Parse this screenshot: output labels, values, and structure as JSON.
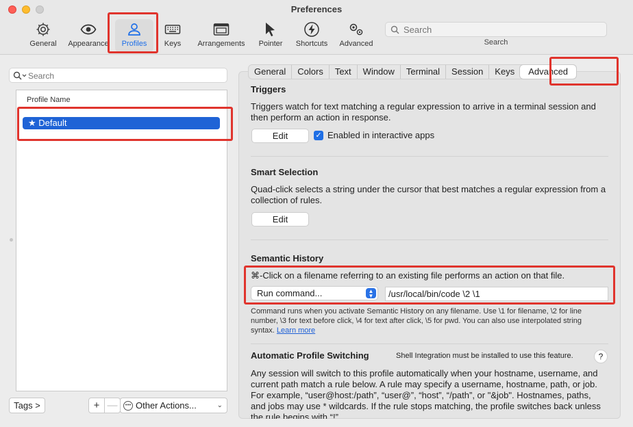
{
  "window": {
    "title": "Preferences"
  },
  "toolbar": {
    "items": [
      {
        "label": "General",
        "icon": "gear-icon"
      },
      {
        "label": "Appearance",
        "icon": "eye-icon"
      },
      {
        "label": "Profiles",
        "icon": "person-icon",
        "selected": true
      },
      {
        "label": "Keys",
        "icon": "keyboard-icon"
      },
      {
        "label": "Arrangements",
        "icon": "windows-icon"
      },
      {
        "label": "Pointer",
        "icon": "cursor-icon"
      },
      {
        "label": "Shortcuts",
        "icon": "lightning-icon"
      },
      {
        "label": "Advanced",
        "icon": "gears-icon"
      }
    ],
    "search": {
      "placeholder": "Search",
      "label": "Search"
    }
  },
  "profiles": {
    "search_placeholder": "Search",
    "column_header": "Profile Name",
    "rows": [
      {
        "name": "★ Default",
        "selected": true
      }
    ],
    "tags_button": "Tags >",
    "add_button": "+",
    "remove_button": "—",
    "other_actions": "Other Actions..."
  },
  "tabs": [
    "General",
    "Colors",
    "Text",
    "Window",
    "Terminal",
    "Session",
    "Keys",
    "Advanced"
  ],
  "selected_tab": "Advanced",
  "advanced": {
    "triggers": {
      "title": "Triggers",
      "description": "Triggers watch for text matching a regular expression to arrive in a terminal session and then perform an action in response.",
      "edit_button": "Edit",
      "enabled_label": "Enabled in interactive apps",
      "enabled_checked": true
    },
    "smart_selection": {
      "title": "Smart Selection",
      "description": "Quad-click selects a string under the cursor that best matches a regular expression from a collection of rules.",
      "edit_button": "Edit"
    },
    "semantic_history": {
      "title": "Semantic History",
      "description": "⌘-Click on a filename referring to an existing file performs an action on that file.",
      "action_selected": "Run command...",
      "command_value": "/usr/local/bin/code \\2 \\1",
      "help_text": "Command runs when you activate Semantic History on any filename. Use \\1 for filename, \\2 for line number, \\3 for text before click, \\4 for text after click, \\5 for pwd. You can also use interpolated string syntax.",
      "learn_more": "Learn more"
    },
    "auto_switching": {
      "title": "Automatic Profile Switching",
      "shell_note": "Shell Integration must be installed to use this feature.",
      "help_button": "?",
      "description": "Any session will switch to this profile automatically when your hostname, username, and current path match a rule below. A rule may specify a username, hostname, path, or job. For example, “user@host:/path”, “user@”, “host”, “/path”, or \"&job\". Hostnames, paths, and jobs may use * wildcards. If the rule stops matching, the profile switches back unless the rule begins with “!”."
    }
  },
  "colors": {
    "accent": "#1f63d6",
    "highlight": "#e0342d"
  }
}
